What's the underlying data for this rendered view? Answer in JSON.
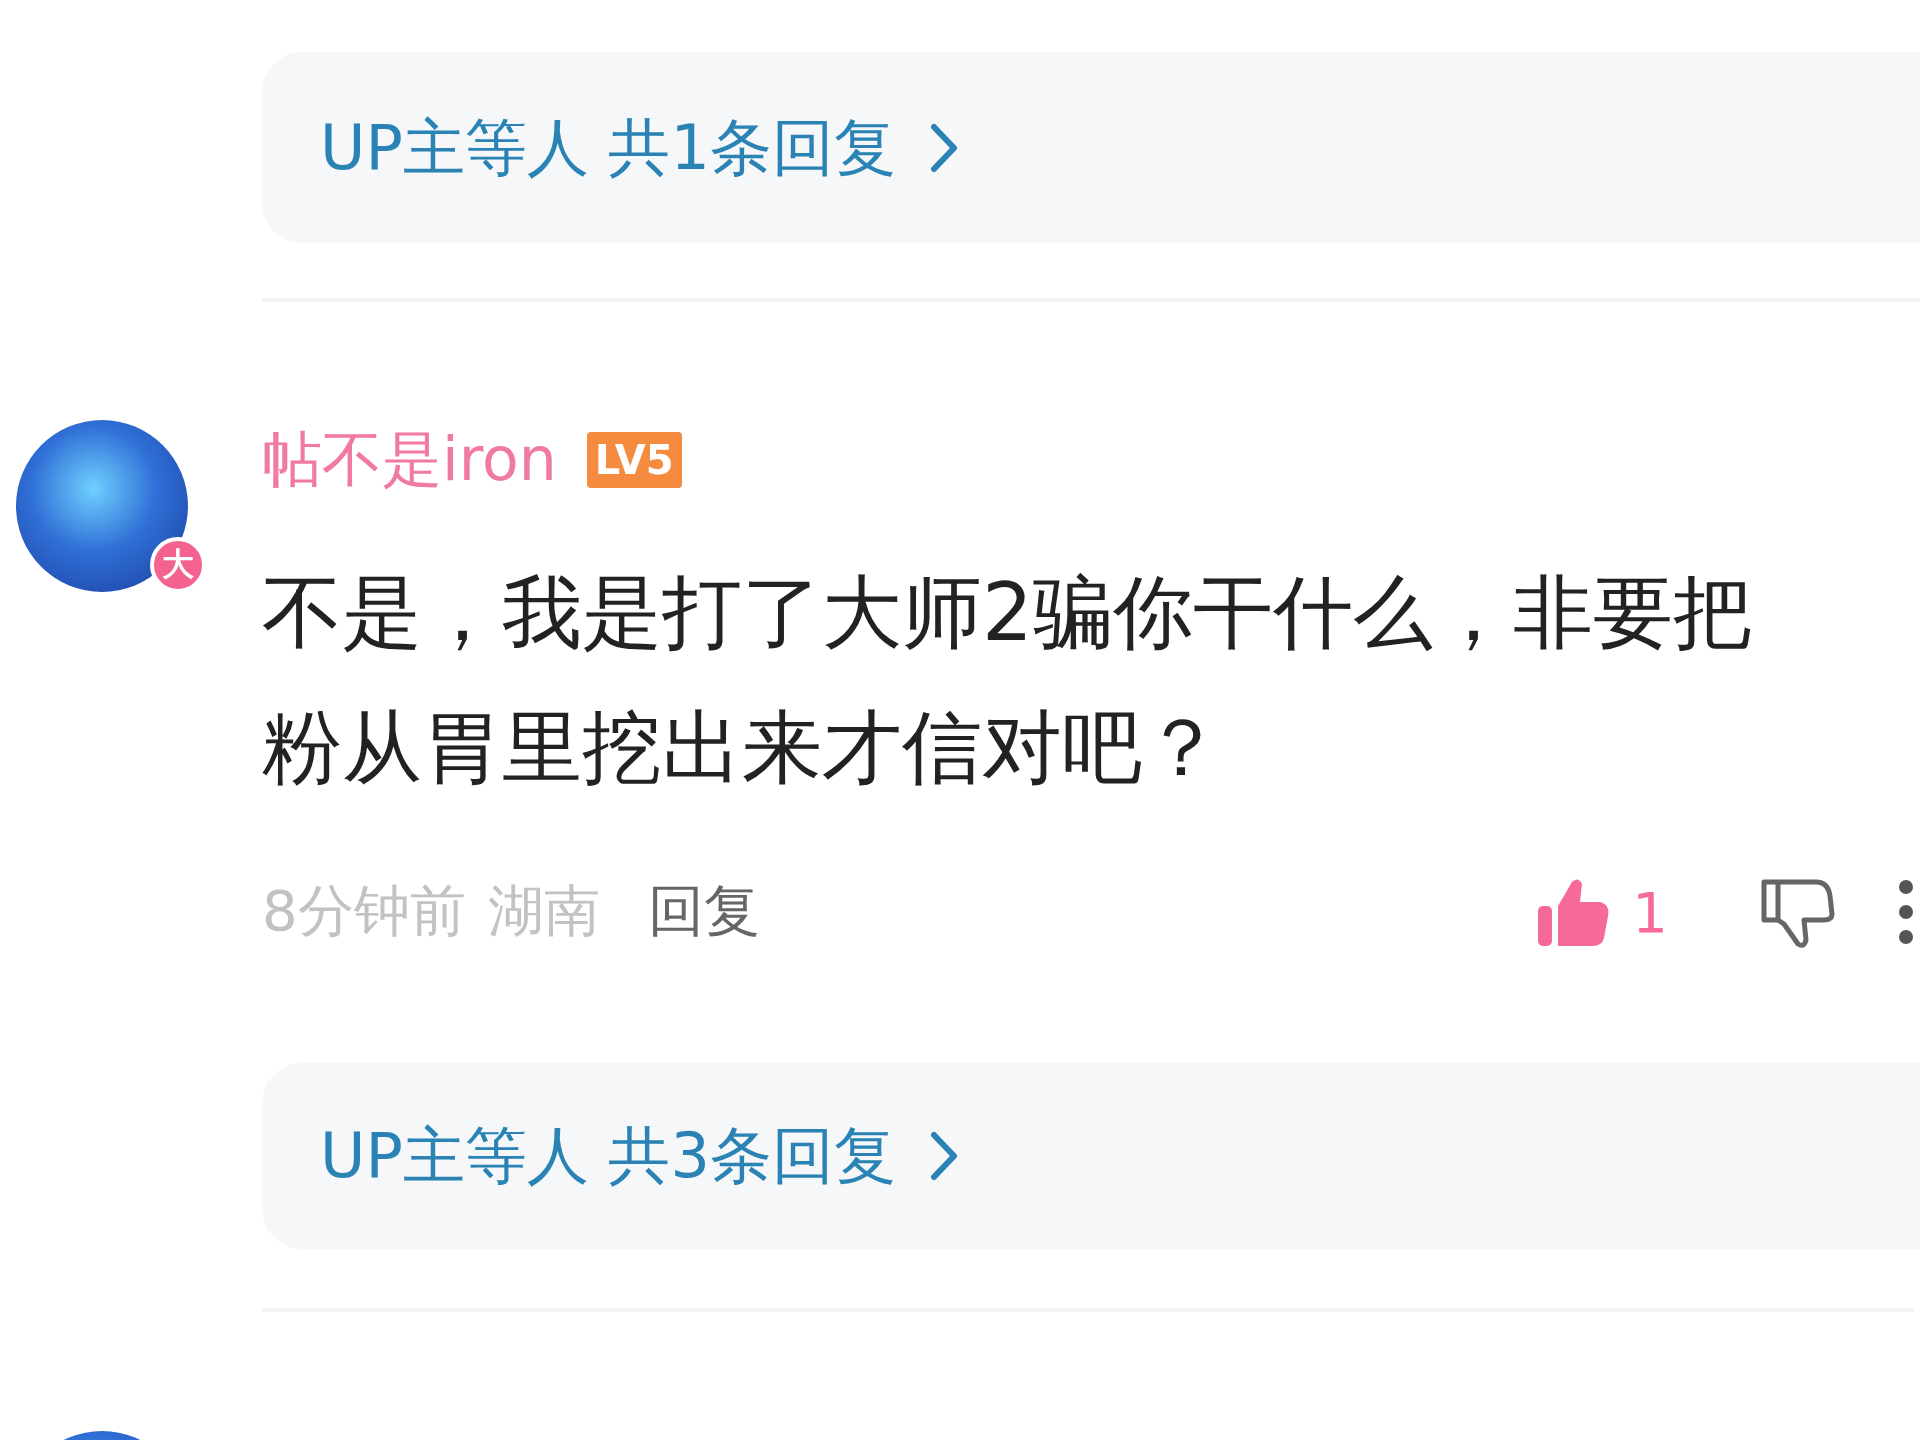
{
  "reply_summary_top": {
    "text": "UP主等人 共1条回复"
  },
  "comment": {
    "username": "帖不是iron",
    "level": "LV5",
    "avatar_badge": "大",
    "text": "不是，我是打了大师2骗你干什么，非要把粉从胃里挖出来才信对吧？",
    "time": "8分钟前",
    "location": "湖南",
    "reply_label": "回复",
    "likes": "1",
    "liked": true,
    "reply_summary": {
      "text": "UP主等人 共3条回复"
    }
  }
}
